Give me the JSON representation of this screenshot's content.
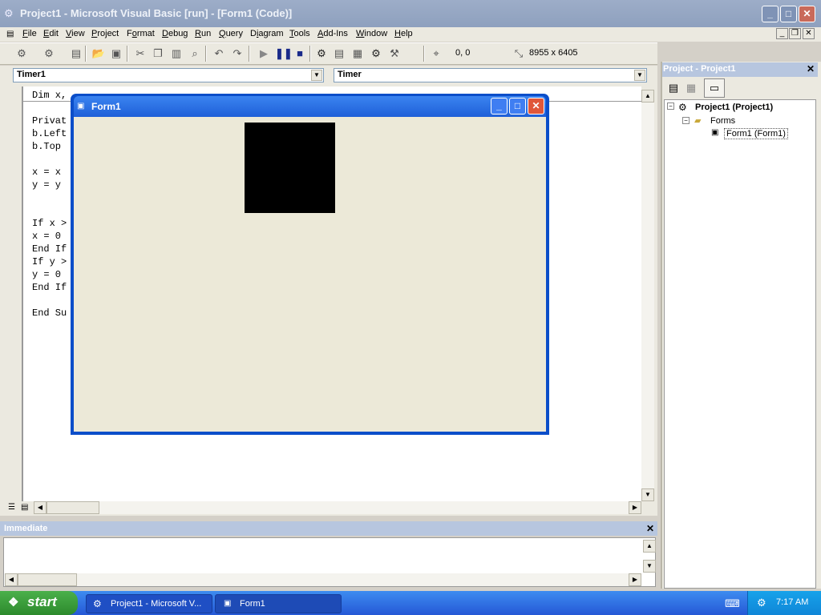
{
  "app": {
    "title": "Project1 - Microsoft Visual Basic [run] - [Form1 (Code)]"
  },
  "menu": {
    "items": [
      {
        "prefix": "",
        "u": "F",
        "rest": "ile"
      },
      {
        "prefix": "",
        "u": "E",
        "rest": "dit"
      },
      {
        "prefix": "",
        "u": "V",
        "rest": "iew"
      },
      {
        "prefix": "",
        "u": "P",
        "rest": "roject"
      },
      {
        "prefix": "F",
        "u": "o",
        "rest": "rmat"
      },
      {
        "prefix": "",
        "u": "D",
        "rest": "ebug"
      },
      {
        "prefix": "",
        "u": "R",
        "rest": "un"
      },
      {
        "prefix": "",
        "u": "Q",
        "rest": "uery"
      },
      {
        "prefix": "D",
        "u": "i",
        "rest": "agram"
      },
      {
        "prefix": "",
        "u": "T",
        "rest": "ools"
      },
      {
        "prefix": "",
        "u": "A",
        "rest": "dd-Ins"
      },
      {
        "prefix": "",
        "u": "W",
        "rest": "indow"
      },
      {
        "prefix": "",
        "u": "H",
        "rest": "elp"
      }
    ]
  },
  "toolbar": {
    "position": "0, 0",
    "size": "8955 x 6405"
  },
  "code": {
    "object_combo": "Timer1",
    "proc_combo": "Timer",
    "lines": [
      "Dim x, ",
      "",
      "Privat",
      "b.Left",
      "b.Top",
      "",
      "x = x",
      "y = y",
      "",
      "",
      "If x >",
      "x = 0",
      "End If",
      "If y >",
      "y = 0",
      "End If",
      "",
      "End Su"
    ]
  },
  "form1": {
    "title": "Form1"
  },
  "project": {
    "title": "Project - Project1",
    "root": "Project1 (Project1)",
    "folder": "Forms",
    "item": "Form1 (Form1)"
  },
  "immediate": {
    "title": "Immediate"
  },
  "taskbar": {
    "start": "start",
    "tasks": [
      "Project1 - Microsoft V...",
      "Form1"
    ],
    "clock": "7:17 AM"
  },
  "colors": {
    "xp_blue": "#2558d6",
    "start_green": "#2c8a2c",
    "form_face": "#ece9d8"
  }
}
